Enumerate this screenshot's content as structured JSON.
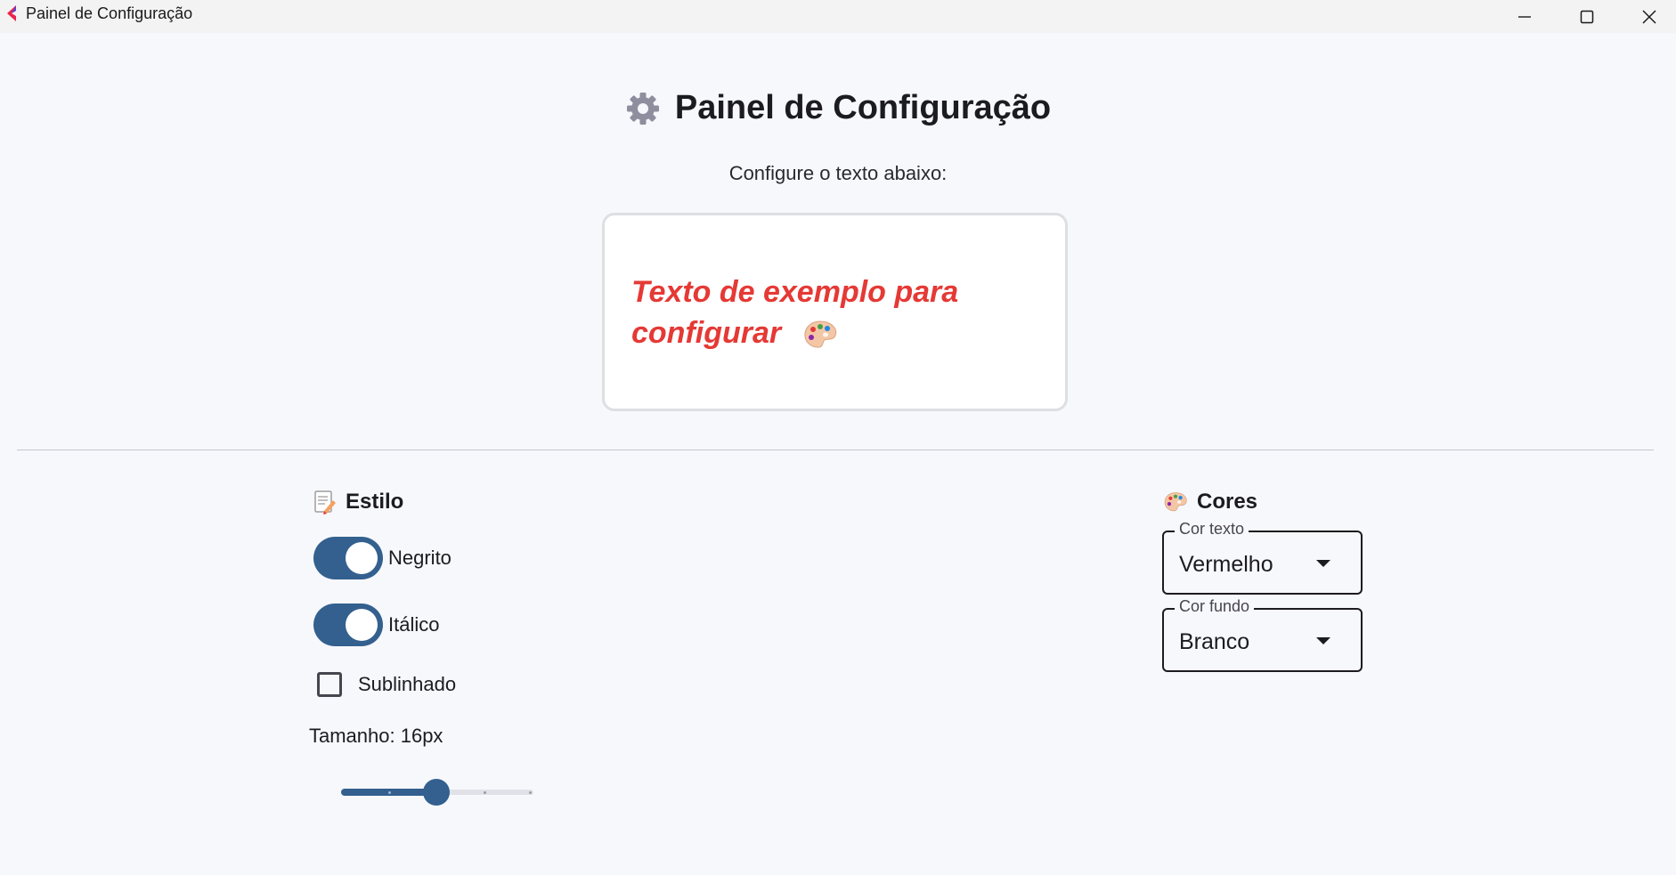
{
  "window": {
    "title": "Painel de Configuração",
    "controls": [
      "minimize-icon",
      "maximize-icon",
      "close-icon"
    ]
  },
  "header": {
    "icon": "gear-icon",
    "title": "Painel de Configuração",
    "subtitle": "Configure o texto abaixo:"
  },
  "preview": {
    "text_line1": "Texto de exemplo para",
    "text_line2": "configurar",
    "emoji": "palette-icon",
    "text_color": "#e53935",
    "background": "#ffffff",
    "bold": true,
    "italic": true,
    "underline": false
  },
  "style_section": {
    "title": "Estilo",
    "icon": "memo-icon",
    "bold_label": "Negrito",
    "bold_on": true,
    "italic_label": "Itálico",
    "italic_on": true,
    "underline_label": "Sublinhado",
    "underline_checked": false,
    "size_label": "Tamanho: 16px",
    "size_slider_fraction": 0.5,
    "accent_color": "#33608f"
  },
  "colors_section": {
    "title": "Cores",
    "icon": "palette-icon",
    "text_color": {
      "label": "Cor texto",
      "value": "Vermelho"
    },
    "bg_color": {
      "label": "Cor fundo",
      "value": "Branco"
    }
  }
}
